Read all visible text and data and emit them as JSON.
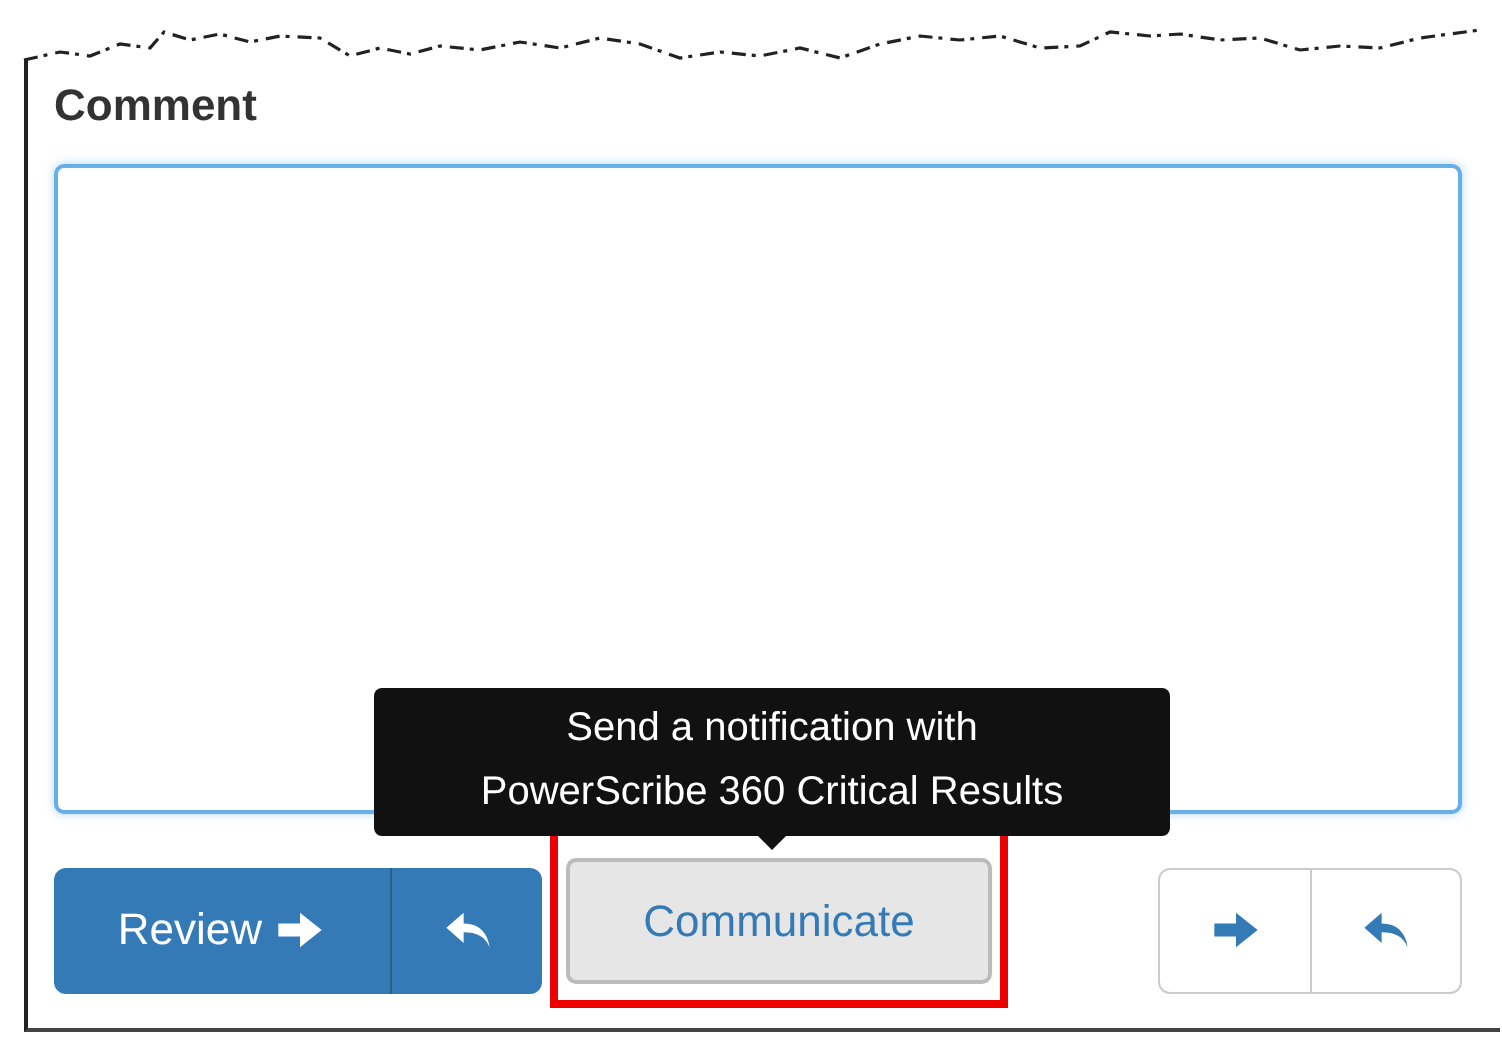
{
  "section": {
    "label": "Comment"
  },
  "tooltip": {
    "text": "Send a notification with\nPowerScribe 360 Critical Results"
  },
  "buttons": [
    {
      "kind": "primary-group",
      "label": "Review"
    },
    {
      "kind": "plain",
      "label": "Communicate",
      "highlighted": true
    },
    {
      "kind": "outline-group"
    }
  ]
}
